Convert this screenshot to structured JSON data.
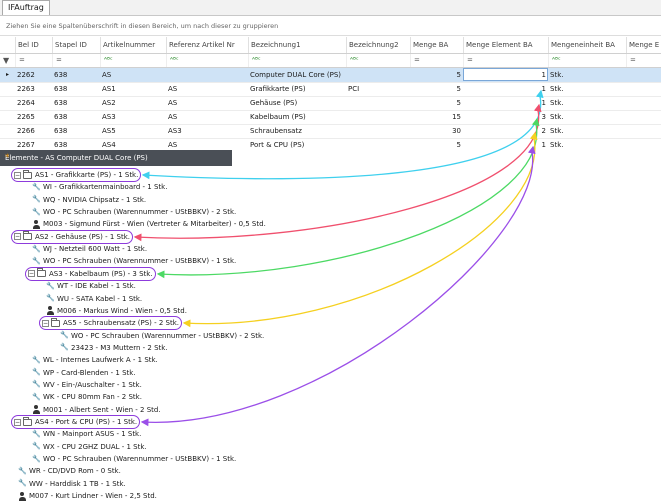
{
  "tab": {
    "label": "IFAuftrag"
  },
  "group_hint": "Ziehen Sie eine Spaltenüberschrift in diesen Bereich, um nach dieser zu gruppieren",
  "columns": [
    "Bel ID",
    "Stapel ID",
    "Artikelnummer",
    "Referenz Artikel Nr",
    "Bezeichnung1",
    "Bezeichnung2",
    "Menge BA",
    "Menge Element BA",
    "Mengeneinheit BA",
    "Menge E"
  ],
  "filter_symbols": {
    "equals": "=",
    "contains": "ᴬᴮᶜ"
  },
  "rows": [
    {
      "bel_id": "2262",
      "stapel_id": "638",
      "artikelnr": "AS",
      "referenz": "",
      "bez1": "Computer DUAL Core (PS)",
      "bez2": "",
      "menge": "5",
      "menge_el": "1",
      "einheit": "Stk."
    },
    {
      "bel_id": "2263",
      "stapel_id": "638",
      "artikelnr": "AS1",
      "referenz": "AS",
      "bez1": "Grafikkarte (PS)",
      "bez2": "PCI",
      "menge": "5",
      "menge_el": "1",
      "einheit": "Stk."
    },
    {
      "bel_id": "2264",
      "stapel_id": "638",
      "artikelnr": "AS2",
      "referenz": "AS",
      "bez1": "Gehäuse (PS)",
      "bez2": "",
      "menge": "5",
      "menge_el": "1",
      "einheit": "Stk."
    },
    {
      "bel_id": "2265",
      "stapel_id": "638",
      "artikelnr": "AS3",
      "referenz": "AS",
      "bez1": "Kabelbaum (PS)",
      "bez2": "",
      "menge": "15",
      "menge_el": "3",
      "einheit": "Stk."
    },
    {
      "bel_id": "2266",
      "stapel_id": "638",
      "artikelnr": "AS5",
      "referenz": "AS3",
      "bez1": "Schraubensatz",
      "bez2": "",
      "menge": "30",
      "menge_el": "2",
      "einheit": "Stk."
    },
    {
      "bel_id": "2267",
      "stapel_id": "638",
      "artikelnr": "AS4",
      "referenz": "AS",
      "bez1": "Port & CPU (PS)",
      "bez2": "",
      "menge": "5",
      "menge_el": "1",
      "einheit": "Stk."
    }
  ],
  "popup": {
    "title": "Elemente - AS Computer DUAL Core (PS)",
    "nodes": [
      {
        "text": "AS1 - Grafikkarte (PS) - 1 Stk.",
        "icon": "folder",
        "toggle": "⊟",
        "level": 0,
        "highlight": true
      },
      {
        "text": "WI - Grafikkartenmainboard - 1 Stk.",
        "icon": "wrench",
        "level": 1
      },
      {
        "text": "WQ - NVIDIA Chipsatz - 1 Stk.",
        "icon": "wrench",
        "level": 1
      },
      {
        "text": "WO - PC Schrauben (Warennummer - UStBBKV) - 2 Stk.",
        "icon": "wrench",
        "level": 1
      },
      {
        "text": "M003 - Sigmund Fürst - Wien (Vertreter & Mitarbeiter) - 0,5 Std.",
        "icon": "person",
        "level": 1
      },
      {
        "text": "AS2 - Gehäuse (PS) - 1 Stk.",
        "icon": "folder",
        "toggle": "⊟",
        "level": 0,
        "highlight": true
      },
      {
        "text": "WJ - Netzteil 600 Watt - 1 Stk.",
        "icon": "wrench",
        "level": 1
      },
      {
        "text": "WO - PC Schrauben (Warennummer - UStBBKV) - 1 Stk.",
        "icon": "wrench",
        "level": 1
      },
      {
        "text": "AS3 - Kabelbaum (PS) - 3 Stk.",
        "icon": "folder",
        "toggle": "⊟",
        "level": 1,
        "highlight": true
      },
      {
        "text": "WT - IDE Kabel - 1 Stk.",
        "icon": "wrench",
        "level": 2
      },
      {
        "text": "WU - SATA Kabel - 1 Stk.",
        "icon": "wrench",
        "level": 2
      },
      {
        "text": "M006 - Markus Wind - Wien - 0,5 Std.",
        "icon": "person",
        "level": 2
      },
      {
        "text": "AS5 - Schraubensatz (PS) - 2 Stk.",
        "icon": "folder",
        "toggle": "⊟",
        "level": 2,
        "highlight": true
      },
      {
        "text": "WO - PC Schrauben (Warennummer - UStBBKV) - 2 Stk.",
        "icon": "wrench",
        "level": 3
      },
      {
        "text": "23423 - M3 Muttern - 2 Stk.",
        "icon": "wrench",
        "level": 3
      },
      {
        "text": "WL - Internes Laufwerk A - 1 Stk.",
        "icon": "wrench",
        "level": 1
      },
      {
        "text": "WP - Card-Blenden - 1 Stk.",
        "icon": "wrench",
        "level": 1
      },
      {
        "text": "WV - Ein-/Auschalter - 1 Stk.",
        "icon": "wrench",
        "level": 1
      },
      {
        "text": "WK - CPU 80mm Fan - 2 Stk.",
        "icon": "wrench",
        "level": 1
      },
      {
        "text": "M001 - Albert Sent - Wien - 2 Std.",
        "icon": "person",
        "level": 1
      },
      {
        "text": "AS4 - Port & CPU (PS) - 1 Stk.",
        "icon": "folder",
        "toggle": "⊟",
        "level": 0,
        "highlight": true
      },
      {
        "text": "WN - Mainport ASUS - 1 Stk.",
        "icon": "wrench",
        "level": 1
      },
      {
        "text": "WX - CPU 2GHZ DUAL - 1 Stk.",
        "icon": "wrench",
        "level": 1
      },
      {
        "text": "WO - PC Schrauben (Warennummer - UStBBKV) - 1 Stk.",
        "icon": "wrench",
        "level": 1
      },
      {
        "text": "WR - CD/DVD Rom - 0 Stk.",
        "icon": "wrench",
        "level": 0
      },
      {
        "text": "WW - Harddisk 1 TB - 1 Stk.",
        "icon": "wrench",
        "level": 0
      },
      {
        "text": "M007 - Kurt Lindner - Wien - 2,5 Std.",
        "icon": "person",
        "level": 0
      }
    ]
  },
  "annotation_colors": {
    "highlight_border": "#8d3bdc",
    "as1": "#3fd0ee",
    "as2": "#f0506e",
    "as3": "#4cd964",
    "as5": "#f5d020",
    "as4": "#9b4fe8"
  }
}
